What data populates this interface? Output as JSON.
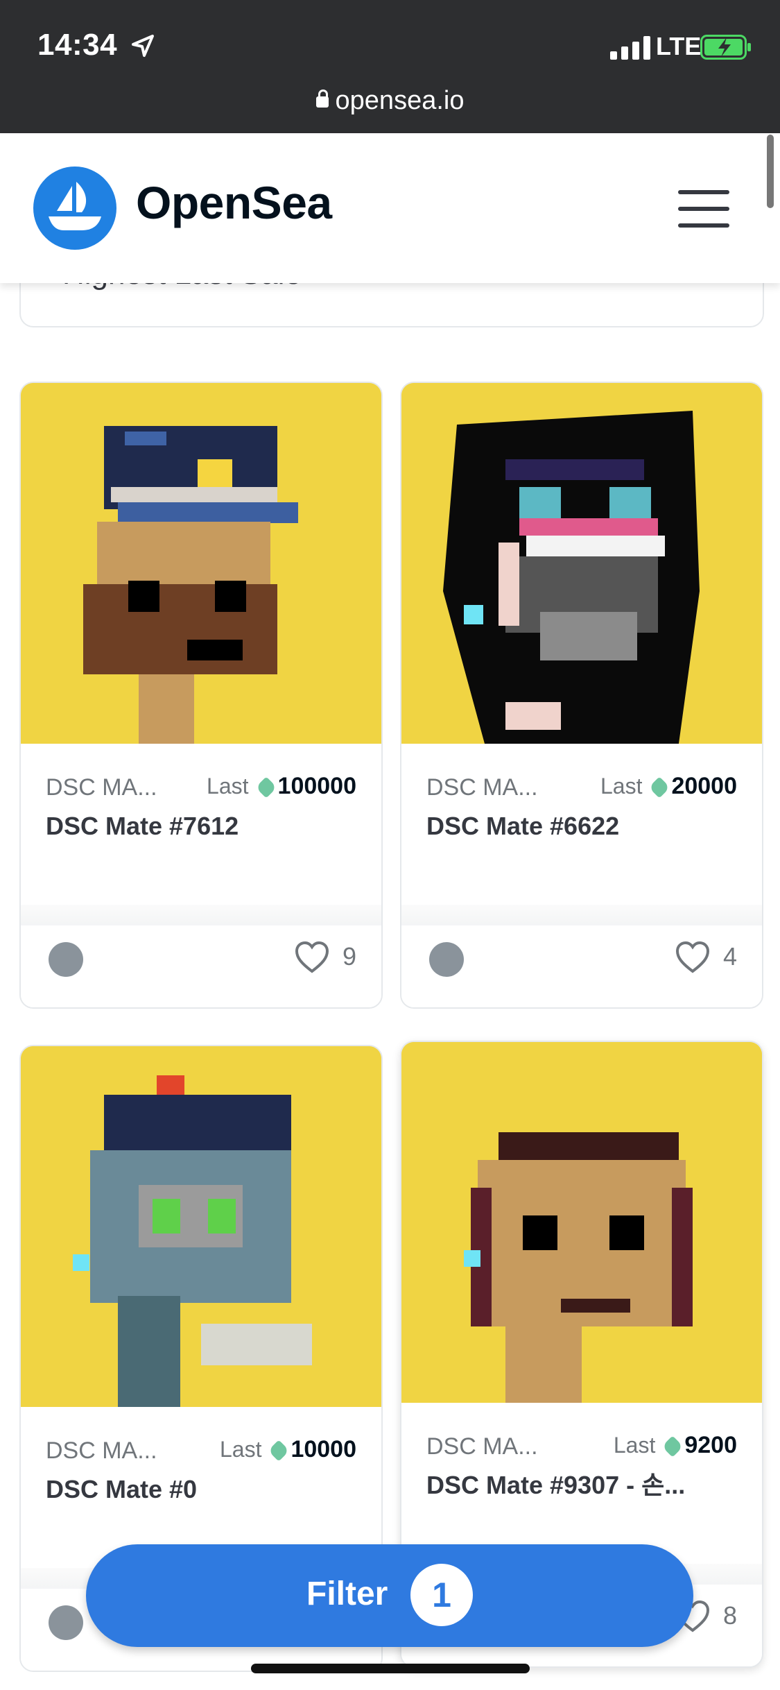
{
  "status_bar": {
    "time": "14:34",
    "network": "LTE",
    "url": "opensea.io"
  },
  "header": {
    "brand": "OpenSea"
  },
  "sort": {
    "label": "Highest Last Sale"
  },
  "cards": [
    {
      "collection": "DSC MA...",
      "last_label": "Last",
      "price": "100000",
      "name": "DSC Mate #7612",
      "favorites": "9"
    },
    {
      "collection": "DSC MA...",
      "last_label": "Last",
      "price": "20000",
      "name": "DSC Mate #6622",
      "favorites": "4"
    },
    {
      "collection": "DSC MA...",
      "last_label": "Last",
      "price": "10000",
      "name": "DSC Mate #0",
      "favorites": ""
    },
    {
      "collection": "DSC MA...",
      "last_label": "Last",
      "price": "9200",
      "name": "DSC Mate #9307 - 손...",
      "favorites": "8"
    }
  ],
  "filter": {
    "label": "Filter",
    "count": "1"
  },
  "colors": {
    "brand_blue": "#2081e2",
    "card_bg": "#f0d443",
    "status_bg": "#2d2e30"
  }
}
